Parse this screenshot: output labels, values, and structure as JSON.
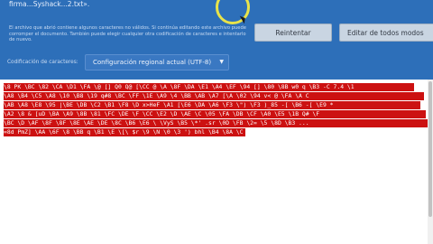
{
  "infobar": {
    "title": "firma...Syshack...2.txt».",
    "body": "El archivo que abrió contiene algunos caracteres no válidos. Si continúa editando este archivo puede corromper el documento. También puede elegir cualquier otra codificación de caracteres e intentarlo de nuevo.",
    "retry_label": "Reintentar",
    "edit_label": "Editar de todos modos",
    "encoding_label": "Codificación de caracteres:",
    "encoding_value": "Configuración regional actual (UTF-8)",
    "bg_color": "#2d6fb9"
  },
  "editor": {
    "lines": [
      "\\8 PK \\BC \\82 \\CA \\D1 \\FA \\@ [] Q0 Q@ [\\CC @ \\A \\8F \\DA \\E1 \\A4 \\EF \\94 [] \\80 \\8B  w0  q \\B3 -C 7.4  \\1",
      "\\A8 \\B4  \\C5 \\A8 \\10 \\B8 \\19  q#8 \\BC \\FF \\1E \\A9 \\4  \\BB \\AB \\A7  [\\A  \\02 \\94  v<  @  \\FA \\A  C",
      "\\AB \\A8 \\E8 \\95 |\\BE \\DB \\C2 \\B1 \\F8 \\D  x>HeF \\A1 [\\E6 \\DA \\A6 \\F3 \\\") \\F3 )_85 -[ \\B6 -[ \\E9 *",
      "\\A2 \\8 &  [uD \\BA \\A9 \\8B \\81 \\FC \\DE \\F \\CC \\E2 \\D \\AE \\C \\05 \\FA \\DB \\CF \\A0 \\E5 \\1B   Q#  \\F",
      "\\BC \\D \\AF \\8F \\8F \\8E \\AE \\DE \\8C \\B6 \\E6 \\ \\VyS \\B5 \\*' .sr \\0D \\FB \\2= \\5 \\8D \\B3 ...",
      "=8d PmZ] \\AA \\6F \\8 \\BB q \\B1 \\E \\[\\ $r \\9 \\N \\0 \\3 ') bhl \\B4 \\8A \\C \\UP \\1e \\65"
    ],
    "status_color": "#cc1111"
  }
}
